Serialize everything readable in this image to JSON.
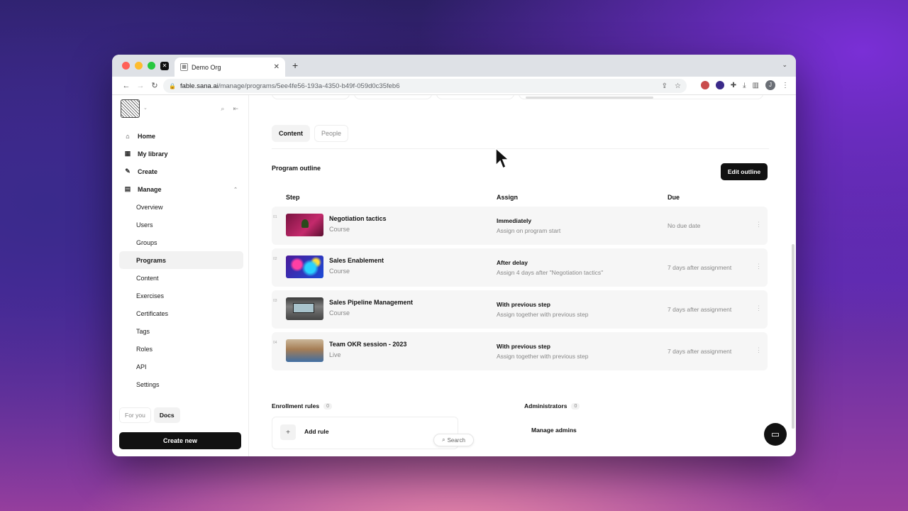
{
  "browser": {
    "tab_title": "Demo Org",
    "url_host": "fable.sana.ai",
    "url_path": "/manage/programs/5ee4fe56-193a-4350-b49f-059d0c35feb6",
    "new_tab": "+",
    "tab_close": "✕"
  },
  "sidebar": {
    "nav": [
      {
        "label": "Home",
        "icon": "home-icon"
      },
      {
        "label": "My library",
        "icon": "grid-icon"
      },
      {
        "label": "Create",
        "icon": "pencil-icon"
      },
      {
        "label": "Manage",
        "icon": "chart-icon"
      }
    ],
    "manage_items": [
      "Overview",
      "Users",
      "Groups",
      "Programs",
      "Content",
      "Exercises",
      "Certificates",
      "Tags",
      "Roles",
      "API",
      "Settings"
    ],
    "active_item": "Programs",
    "footer_tabs": [
      "For you",
      "Docs"
    ],
    "create_new": "Create new"
  },
  "main": {
    "tabs": [
      "Content",
      "People"
    ],
    "active_tab": "Content",
    "section_title": "Program outline",
    "edit_outline": "Edit outline",
    "columns": {
      "step": "Step",
      "assign": "Assign",
      "due": "Due"
    },
    "steps": [
      {
        "num": "01",
        "title": "Negotiation tactics",
        "type": "Course",
        "assign": "Immediately",
        "assign_sub": "Assign on program start",
        "due": "No due date"
      },
      {
        "num": "02",
        "title": "Sales Enablement",
        "type": "Course",
        "assign": "After delay",
        "assign_sub": "Assign 4 days after \"Negotiation tactics\"",
        "due": "7 days after assignment"
      },
      {
        "num": "03",
        "title": "Sales Pipeline Management",
        "type": "Course",
        "assign": "With previous step",
        "assign_sub": "Assign together with previous step",
        "due": "7 days after assignment"
      },
      {
        "num": "04",
        "title": "Team OKR session - 2023",
        "type": "Live",
        "assign": "With previous step",
        "assign_sub": "Assign together with previous step",
        "due": "7 days after assignment"
      }
    ],
    "enrollment": {
      "label": "Enrollment rules",
      "count": "0",
      "add_rule": "Add rule"
    },
    "administrators": {
      "label": "Administrators",
      "count": "0",
      "manage": "Manage admins"
    },
    "search": "Search"
  }
}
